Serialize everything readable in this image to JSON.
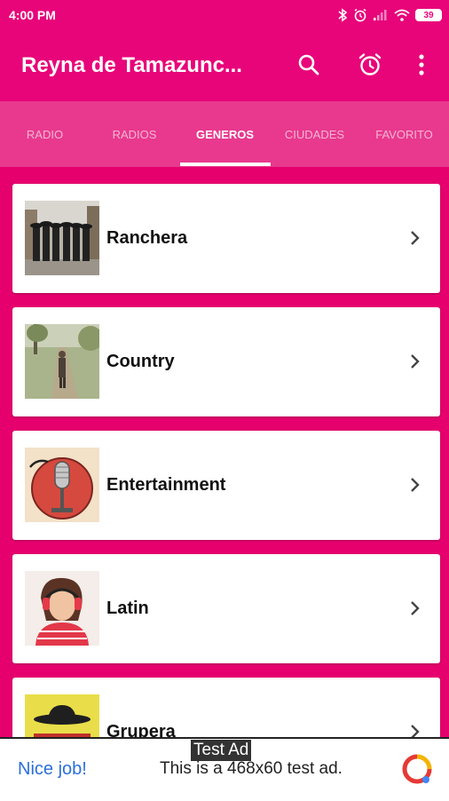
{
  "status": {
    "time": "4:00 PM",
    "battery": "39"
  },
  "app": {
    "title": "Reyna de Tamazunc..."
  },
  "tabs": [
    {
      "label": "RADIO",
      "active": false
    },
    {
      "label": "RADIOS",
      "active": false
    },
    {
      "label": "GENEROS",
      "active": true
    },
    {
      "label": "CIUDADES",
      "active": false
    },
    {
      "label": "FAVORITO",
      "active": false
    }
  ],
  "genres": [
    {
      "label": "Ranchera",
      "icon": "mariachi-photo"
    },
    {
      "label": "Country",
      "icon": "road-photo"
    },
    {
      "label": "Entertainment",
      "icon": "microphone-photo"
    },
    {
      "label": "Latin",
      "icon": "headphones-girl-photo"
    },
    {
      "label": "Grupera",
      "icon": "hat-photo"
    }
  ],
  "ad": {
    "badge": "Test Ad",
    "left": "Nice job!",
    "text": "This is a 468x60 test ad."
  },
  "colors": {
    "primary": "#e8057a",
    "tab_bg": "#e8398e",
    "accent_blue": "#2a6fdb"
  }
}
